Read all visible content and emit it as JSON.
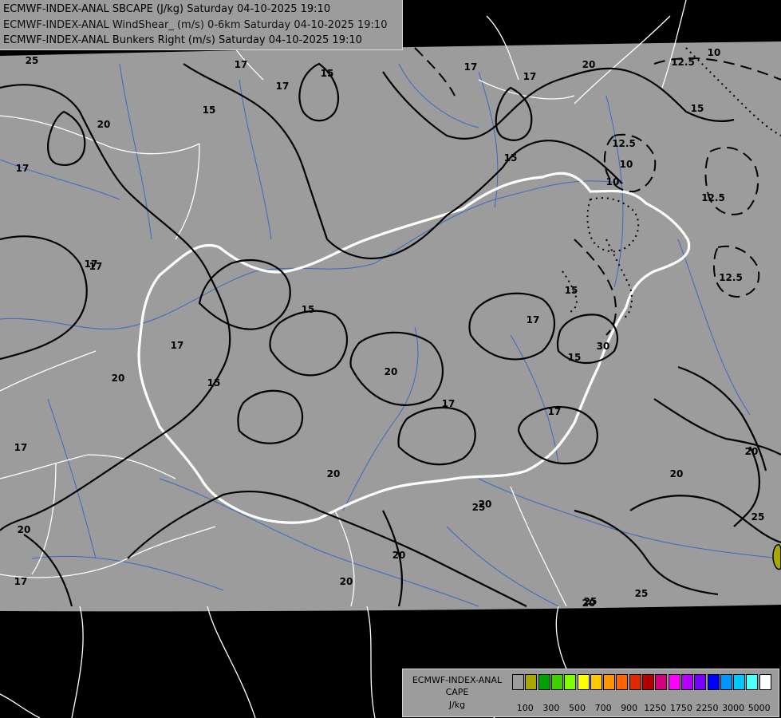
{
  "titles": [
    "ECMWF-INDEX-ANAL SBCAPE (J/kg) Saturday 04-10-2025 19:10",
    "ECMWF-INDEX-ANAL WindShear_ (m/s) 0-6km Saturday 04-10-2025 19:10",
    "ECMWF-INDEX-ANAL Bunkers Right (m/s) Saturday 04-10-2025 19:10"
  ],
  "legend": {
    "name_lines": [
      "ECMWF-INDEX-ANAL",
      "CAPE",
      "J/kg"
    ],
    "colors": [
      "#9c9c9c",
      "#a8a800",
      "#00a000",
      "#40d000",
      "#80ff00",
      "#ffff00",
      "#ffc800",
      "#ff9600",
      "#ff6400",
      "#e02800",
      "#b40000",
      "#d2007d",
      "#ff00ff",
      "#b400ff",
      "#7800ff",
      "#0000ff",
      "#0096ff",
      "#00c8ff",
      "#50ffff",
      "#ffffff"
    ],
    "ticks": [
      {
        "label": "100",
        "index": 1
      },
      {
        "label": "300",
        "index": 3
      },
      {
        "label": "500",
        "index": 5
      },
      {
        "label": "700",
        "index": 7
      },
      {
        "label": "900",
        "index": 9
      },
      {
        "label": "1250",
        "index": 11
      },
      {
        "label": "1750",
        "index": 13
      },
      {
        "label": "2250",
        "index": 15
      },
      {
        "label": "3000",
        "index": 17
      },
      {
        "label": "5000",
        "index": 19
      }
    ]
  },
  "contour_labels": [
    "25",
    "17",
    "15",
    "17",
    "20",
    "17",
    "15",
    "17",
    "17",
    "20",
    "15",
    "17",
    "20",
    "15",
    "20",
    "17",
    "15",
    "17",
    "20",
    "17",
    "15",
    "17",
    "15",
    "20",
    "17",
    "17",
    "20",
    "20",
    "20",
    "20",
    "20",
    "20",
    "25",
    "25",
    "25",
    "25",
    "30",
    "17",
    "12.5",
    "10",
    "15",
    "12.5",
    "10",
    "12.5",
    "12.5",
    "10"
  ],
  "colors": {
    "land": "#9c9c9c",
    "outside": "#000000",
    "rivers": "#3a6ac0",
    "borders": "#ffffff",
    "cape_low": "#a8a800"
  }
}
